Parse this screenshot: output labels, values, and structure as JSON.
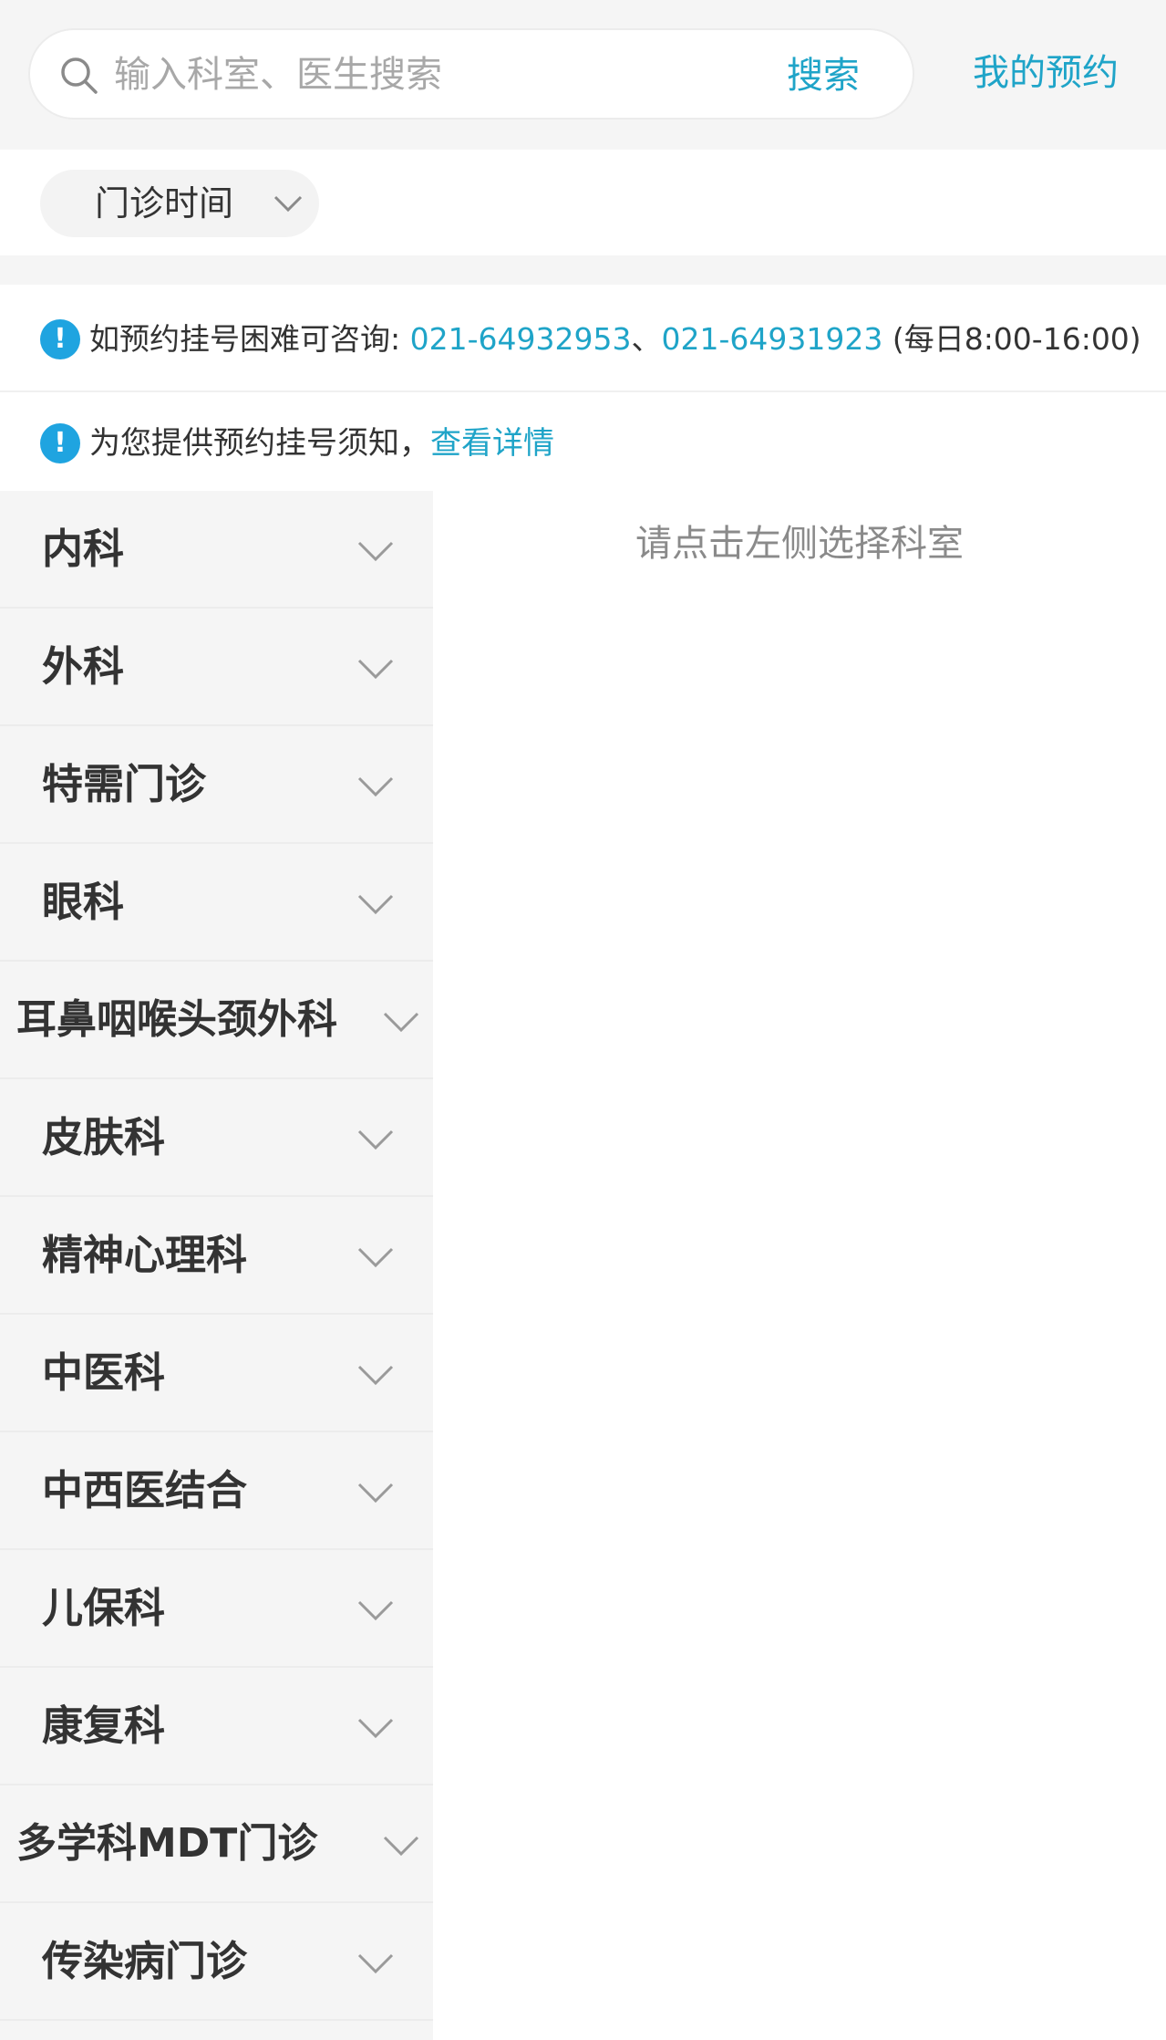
{
  "search": {
    "placeholder": "输入科室、医生搜索",
    "value": "",
    "button_label": "搜索"
  },
  "header": {
    "my_appointments": "我的预约"
  },
  "filter": {
    "time_label": "门诊时间"
  },
  "notices": [
    {
      "prefix": "如预约挂号困难可咨询: ",
      "phone1": "021-64932953",
      "separator": "、",
      "phone2": "021-64931923",
      "suffix": " (每日8:00-16:00)"
    },
    {
      "prefix": "为您提供预约挂号须知，",
      "link": "查看详情"
    }
  ],
  "departments": [
    {
      "label": "内科"
    },
    {
      "label": "外科"
    },
    {
      "label": "特需门诊"
    },
    {
      "label": "眼科"
    },
    {
      "label": "耳鼻咽喉头颈外科"
    },
    {
      "label": "皮肤科"
    },
    {
      "label": "精神心理科"
    },
    {
      "label": "中医科"
    },
    {
      "label": "中西医结合"
    },
    {
      "label": "儿保科"
    },
    {
      "label": "康复科"
    },
    {
      "label": "多学科MDT门诊"
    },
    {
      "label": "传染病门诊"
    }
  ],
  "content": {
    "empty_hint": "请点击左侧选择科室"
  },
  "icons": {
    "search": "search-icon",
    "chevron": "chevron-down-icon",
    "info": "info-icon"
  },
  "colors": {
    "accent": "#1fa4c8",
    "info_icon": "#1fa4e0",
    "background": "#f5f5f5"
  }
}
